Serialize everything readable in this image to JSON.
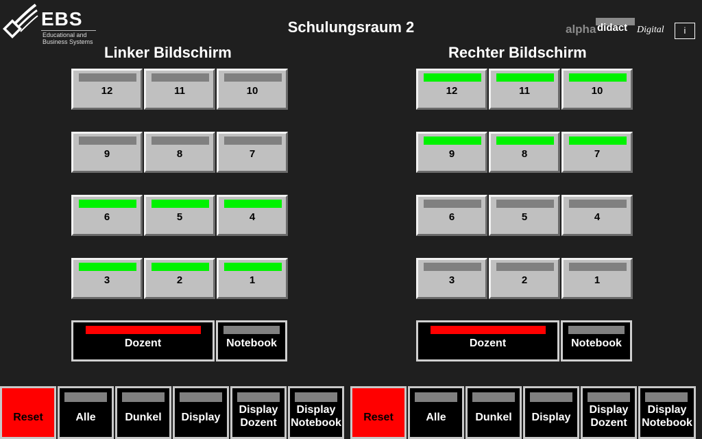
{
  "header": {
    "logo_text": "EBS",
    "logo_subtitle_1": "Educational and",
    "logo_subtitle_2": "Business Systems",
    "title": "Schulungsraum 2",
    "brand_alpha": "alpha",
    "brand_didact": "didact",
    "brand_digital": "Digital",
    "info_label": "i"
  },
  "left": {
    "title": "Linker Bildschirm",
    "screens": [
      {
        "label": "12",
        "state": "off"
      },
      {
        "label": "11",
        "state": "off"
      },
      {
        "label": "10",
        "state": "off"
      },
      {
        "label": "9",
        "state": "off"
      },
      {
        "label": "8",
        "state": "off"
      },
      {
        "label": "7",
        "state": "off"
      },
      {
        "label": "6",
        "state": "on"
      },
      {
        "label": "5",
        "state": "on"
      },
      {
        "label": "4",
        "state": "on"
      },
      {
        "label": "3",
        "state": "on"
      },
      {
        "label": "2",
        "state": "on"
      },
      {
        "label": "1",
        "state": "on"
      }
    ],
    "source_dozent": "Dozent",
    "source_notebook": "Notebook"
  },
  "right": {
    "title": "Rechter Bildschirm",
    "screens": [
      {
        "label": "12",
        "state": "on"
      },
      {
        "label": "11",
        "state": "on"
      },
      {
        "label": "10",
        "state": "on"
      },
      {
        "label": "9",
        "state": "on"
      },
      {
        "label": "8",
        "state": "on"
      },
      {
        "label": "7",
        "state": "on"
      },
      {
        "label": "6",
        "state": "off"
      },
      {
        "label": "5",
        "state": "off"
      },
      {
        "label": "4",
        "state": "off"
      },
      {
        "label": "3",
        "state": "off"
      },
      {
        "label": "2",
        "state": "off"
      },
      {
        "label": "1",
        "state": "off"
      }
    ],
    "source_dozent": "Dozent",
    "source_notebook": "Notebook"
  },
  "bottom_left": {
    "reset": "Reset",
    "alle": "Alle",
    "dunkel": "Dunkel",
    "display": "Display",
    "display_dozent_1": "Display",
    "display_dozent_2": "Dozent",
    "display_notebook_1": "Display",
    "display_notebook_2": "Notebook"
  },
  "bottom_right": {
    "reset": "Reset",
    "alle": "Alle",
    "dunkel": "Dunkel",
    "display": "Display",
    "display_dozent_1": "Display",
    "display_dozent_2": "Dozent",
    "display_notebook_1": "Display",
    "display_notebook_2": "Notebook"
  },
  "colors": {
    "background": "#1f1f1f",
    "indicator_on": "#00f200",
    "indicator_off": "#808080",
    "indicator_active_source": "#ff0000",
    "reset": "#ff0000",
    "button_face": "#c0c0c0"
  }
}
